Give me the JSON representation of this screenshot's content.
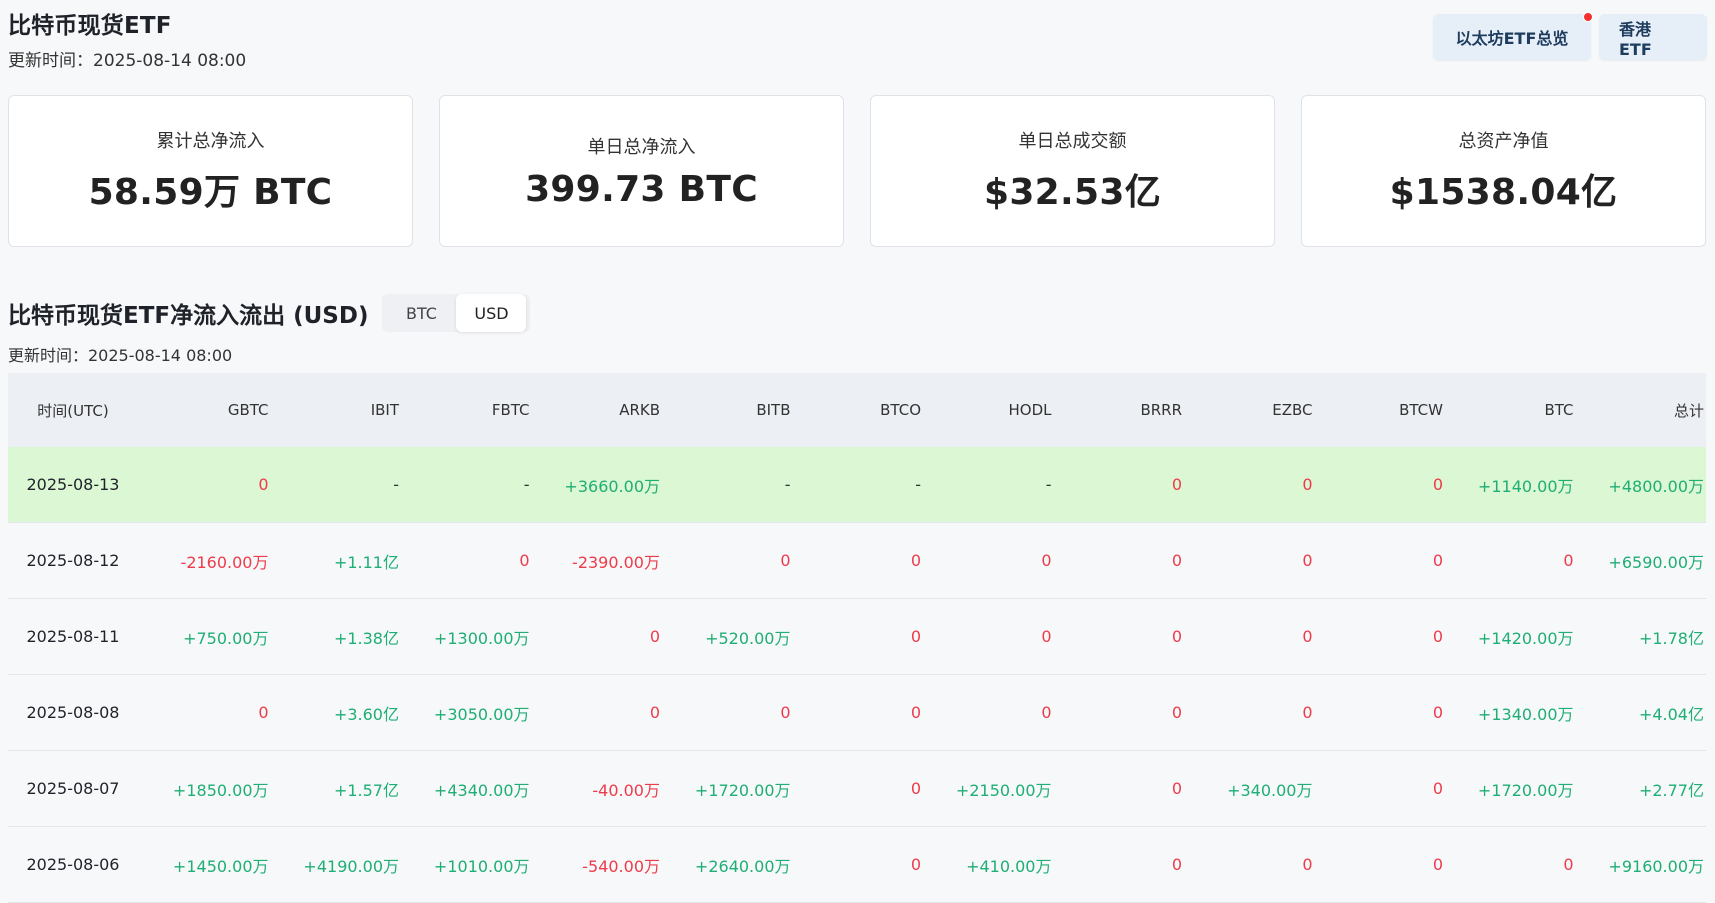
{
  "header": {
    "title": "比特币现货ETF",
    "update_time": "更新时间：2025-08-14 08:00",
    "nav": {
      "eth_overview": "以太坊ETF总览",
      "hk_etf": "香港 ETF"
    }
  },
  "stats": [
    {
      "label": "累计总净流入",
      "value": "58.59万 BTC"
    },
    {
      "label": "单日总净流入",
      "value": "399.73 BTC"
    },
    {
      "label": "单日总成交额",
      "value": "$32.53亿"
    },
    {
      "label": "总资产净值",
      "value": "$1538.04亿"
    }
  ],
  "section": {
    "title": "比特币现货ETF净流入流出 (USD)",
    "toggle": {
      "btc": "BTC",
      "usd": "USD",
      "active": "USD"
    },
    "update_time": "更新时间：2025-08-14 08:00"
  },
  "table": {
    "columns": [
      "时间(UTC)",
      "GBTC",
      "IBIT",
      "FBTC",
      "ARKB",
      "BITB",
      "BTCO",
      "HODL",
      "BRRR",
      "EZBC",
      "BTCW",
      "BTC",
      "总计"
    ],
    "rows": [
      [
        "2025-08-13",
        "0",
        "-",
        "-",
        "+3660.00万",
        "-",
        "-",
        "-",
        "0",
        "0",
        "0",
        "+1140.00万",
        "+4800.00万"
      ],
      [
        "2025-08-12",
        "-2160.00万",
        "+1.11亿",
        "0",
        "-2390.00万",
        "0",
        "0",
        "0",
        "0",
        "0",
        "0",
        "0",
        "+6590.00万"
      ],
      [
        "2025-08-11",
        "+750.00万",
        "+1.38亿",
        "+1300.00万",
        "0",
        "+520.00万",
        "0",
        "0",
        "0",
        "0",
        "0",
        "+1420.00万",
        "+1.78亿"
      ],
      [
        "2025-08-08",
        "0",
        "+3.60亿",
        "+3050.00万",
        "0",
        "0",
        "0",
        "0",
        "0",
        "0",
        "0",
        "+1340.00万",
        "+4.04亿"
      ],
      [
        "2025-08-07",
        "+1850.00万",
        "+1.57亿",
        "+4340.00万",
        "-40.00万",
        "+1720.00万",
        "0",
        "+2150.00万",
        "0",
        "+340.00万",
        "0",
        "+1720.00万",
        "+2.77亿"
      ],
      [
        "2025-08-06",
        "+1450.00万",
        "+4190.00万",
        "+1010.00万",
        "-540.00万",
        "+2640.00万",
        "0",
        "+410.00万",
        "0",
        "0",
        "0",
        "0",
        "+9160.00万"
      ]
    ]
  },
  "colors": {
    "positive": "#1fae74",
    "negative": "#ee3b4a",
    "highlight_row": "#dcf7d4"
  }
}
